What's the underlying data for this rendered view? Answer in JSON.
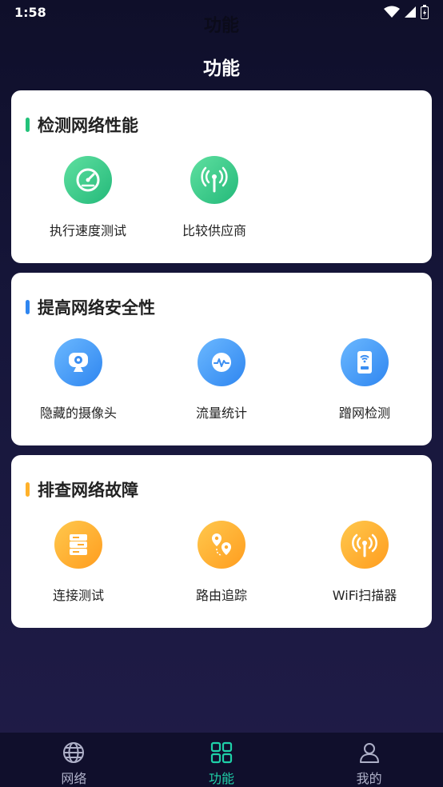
{
  "status_bar": {
    "time": "1:58"
  },
  "header": {
    "ghost_title": "功能",
    "title": "功能"
  },
  "sections": [
    {
      "title": "检测网络性能",
      "accent": "#23c27a",
      "items": [
        {
          "label": "执行速度测试",
          "icon": "speedometer-icon",
          "color": "green"
        },
        {
          "label": "比较供应商",
          "icon": "antenna-icon",
          "color": "green"
        }
      ]
    },
    {
      "title": "提高网络安全性",
      "accent": "#2f86f0",
      "items": [
        {
          "label": "隐藏的摄像头",
          "icon": "camera-icon",
          "color": "blue"
        },
        {
          "label": "流量统计",
          "icon": "pulse-icon",
          "color": "blue"
        },
        {
          "label": "蹭网检测",
          "icon": "router-icon",
          "color": "blue"
        }
      ]
    },
    {
      "title": "排查网络故障",
      "accent": "#ffb12a",
      "items": [
        {
          "label": "连接测试",
          "icon": "server-icon",
          "color": "orange"
        },
        {
          "label": "路由追踪",
          "icon": "route-pin-icon",
          "color": "orange"
        },
        {
          "label": "WiFi扫描器",
          "icon": "wifi-scanner-icon",
          "color": "orange"
        }
      ]
    }
  ],
  "bottom_nav": [
    {
      "label": "网络",
      "icon": "globe-icon",
      "active": false
    },
    {
      "label": "功能",
      "icon": "grid-icon",
      "active": true
    },
    {
      "label": "我的",
      "icon": "profile-icon",
      "active": false
    }
  ],
  "colors": {
    "active_tab": "#1fd0a8",
    "inactive_tab": "#aeb0c8"
  }
}
